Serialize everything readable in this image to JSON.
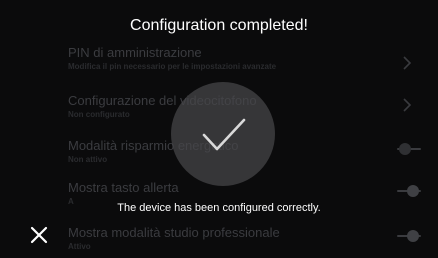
{
  "overlay": {
    "title": "Configuration completed!",
    "message": "The device has been configured correctly.",
    "check_icon": "checkmark-icon",
    "close_icon": "close-icon"
  },
  "settings": {
    "items": [
      {
        "title": "PIN di amministrazione",
        "subtitle": "Modifica il pin necessario per le impostazioni avanzate",
        "control": "chevron-right-icon"
      },
      {
        "title": "Configurazione del videocitofono",
        "subtitle": "Non configurato",
        "control": "chevron-right-icon"
      },
      {
        "title": "Modalità risparmio energetico",
        "subtitle": "Non attivo",
        "control": "toggle",
        "toggle_on": false
      },
      {
        "title": "Mostra tasto allerta",
        "subtitle": "A",
        "control": "toggle",
        "toggle_on": true
      },
      {
        "title": "Mostra modalità studio professionale",
        "subtitle": "Attivo",
        "control": "toggle",
        "toggle_on": true
      }
    ]
  },
  "colors": {
    "background": "#0b0b0c",
    "overlay_text": "#ffffff",
    "dimmed_text": "#3b3c40",
    "check_circle": "#46464a"
  }
}
